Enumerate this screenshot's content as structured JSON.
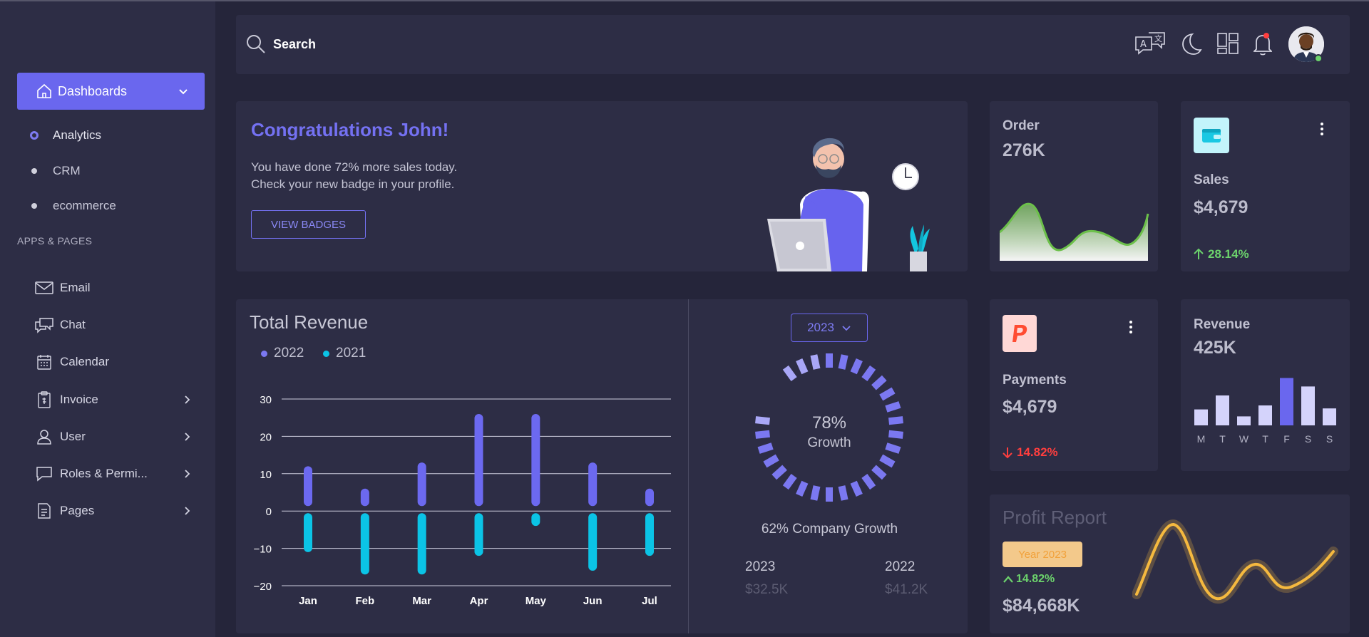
{
  "sidebar": {
    "dashboards_label": "Dashboards",
    "sub_items": [
      {
        "label": "Analytics",
        "active": true
      },
      {
        "label": "CRM",
        "active": false
      },
      {
        "label": "ecommerce",
        "active": false
      }
    ],
    "section_label": "APPS & PAGES",
    "nav_items": [
      {
        "label": "Email",
        "icon": "mail-icon"
      },
      {
        "label": "Chat",
        "icon": "chat-icon"
      },
      {
        "label": "Calendar",
        "icon": "calendar-icon"
      },
      {
        "label": "Invoice",
        "icon": "invoice-icon"
      },
      {
        "label": "User",
        "icon": "user-icon"
      },
      {
        "label": "Roles & Permi...",
        "icon": "chat-bubble-icon"
      },
      {
        "label": "Pages",
        "icon": "pages-icon"
      }
    ]
  },
  "topbar": {
    "search_label": "Search",
    "icons": [
      "translate-icon",
      "moon-icon",
      "apps-grid-icon",
      "bell-icon"
    ]
  },
  "congrats": {
    "title": "Congratulations John!",
    "line1": "You have done 72% more sales today.",
    "line2": "Check your new badge in your profile.",
    "button": "VIEW BADGES"
  },
  "order": {
    "label": "Order",
    "value": "276K"
  },
  "sales": {
    "label": "Sales",
    "value": "$4,679",
    "change": "28.14%"
  },
  "payments": {
    "label": "Payments",
    "value": "$4,679",
    "change": "14.82%"
  },
  "revenue_card": {
    "label": "Revenue",
    "value": "425K"
  },
  "total_revenue": {
    "title": "Total Revenue",
    "legend": [
      "2022",
      "2021"
    ]
  },
  "growth": {
    "year_selected": "2023",
    "percent": "78%",
    "percent_label": "Growth",
    "company_growth": "62% Company Growth",
    "col1_year": "2023",
    "col1_value": "$32.5K",
    "col2_year": "2022",
    "col2_value": "$41.2K"
  },
  "profit": {
    "title": "Profit Report",
    "year_badge": "Year 2023",
    "change": "14.82%",
    "value": "$84,668K"
  },
  "colors": {
    "accent": "#6a67ee",
    "cyan": "#09c4e6",
    "success": "#6cd36c",
    "danger": "#ff3e3e",
    "warning": "#f5b93f"
  },
  "chart_data": [
    {
      "type": "bar",
      "title": "Total Revenue",
      "categories": [
        "Jan",
        "Feb",
        "Mar",
        "Apr",
        "May",
        "Jun",
        "Jul"
      ],
      "series": [
        {
          "name": "2022",
          "values": [
            12,
            6,
            13,
            26,
            26,
            13,
            6
          ]
        },
        {
          "name": "2021",
          "values": [
            -11,
            -17,
            -17,
            -12,
            -4,
            -16,
            -12
          ]
        }
      ],
      "yticks": [
        "30",
        "20",
        "10",
        "0",
        "−10",
        "−20"
      ],
      "ylim": [
        -20,
        30
      ],
      "grid": true,
      "legend_position": "top-left"
    },
    {
      "type": "bar",
      "title": "Revenue",
      "categories": [
        "M",
        "T",
        "W",
        "T",
        "F",
        "S",
        "S"
      ],
      "values": [
        32,
        60,
        18,
        40,
        95,
        78,
        34
      ],
      "highlight_index": 4
    }
  ]
}
